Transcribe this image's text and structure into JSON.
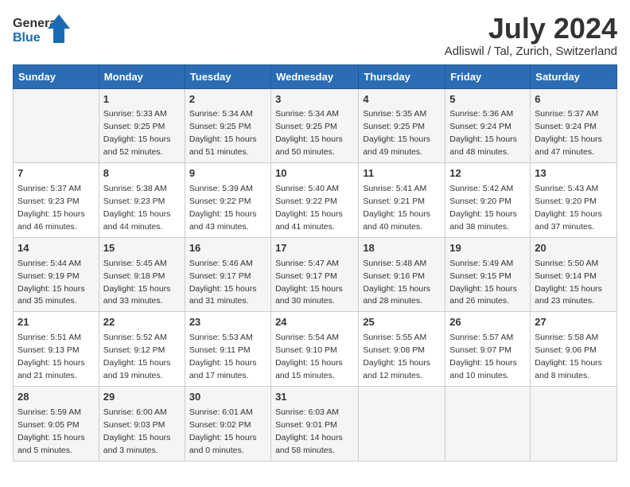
{
  "header": {
    "logo_general": "General",
    "logo_blue": "Blue",
    "title": "July 2024",
    "subtitle": "Adliswil / Tal, Zurich, Switzerland"
  },
  "days_of_week": [
    "Sunday",
    "Monday",
    "Tuesday",
    "Wednesday",
    "Thursday",
    "Friday",
    "Saturday"
  ],
  "weeks": [
    [
      {
        "day": "",
        "info": ""
      },
      {
        "day": "1",
        "info": "Sunrise: 5:33 AM\nSunset: 9:25 PM\nDaylight: 15 hours\nand 52 minutes."
      },
      {
        "day": "2",
        "info": "Sunrise: 5:34 AM\nSunset: 9:25 PM\nDaylight: 15 hours\nand 51 minutes."
      },
      {
        "day": "3",
        "info": "Sunrise: 5:34 AM\nSunset: 9:25 PM\nDaylight: 15 hours\nand 50 minutes."
      },
      {
        "day": "4",
        "info": "Sunrise: 5:35 AM\nSunset: 9:25 PM\nDaylight: 15 hours\nand 49 minutes."
      },
      {
        "day": "5",
        "info": "Sunrise: 5:36 AM\nSunset: 9:24 PM\nDaylight: 15 hours\nand 48 minutes."
      },
      {
        "day": "6",
        "info": "Sunrise: 5:37 AM\nSunset: 9:24 PM\nDaylight: 15 hours\nand 47 minutes."
      }
    ],
    [
      {
        "day": "7",
        "info": "Sunrise: 5:37 AM\nSunset: 9:23 PM\nDaylight: 15 hours\nand 46 minutes."
      },
      {
        "day": "8",
        "info": "Sunrise: 5:38 AM\nSunset: 9:23 PM\nDaylight: 15 hours\nand 44 minutes."
      },
      {
        "day": "9",
        "info": "Sunrise: 5:39 AM\nSunset: 9:22 PM\nDaylight: 15 hours\nand 43 minutes."
      },
      {
        "day": "10",
        "info": "Sunrise: 5:40 AM\nSunset: 9:22 PM\nDaylight: 15 hours\nand 41 minutes."
      },
      {
        "day": "11",
        "info": "Sunrise: 5:41 AM\nSunset: 9:21 PM\nDaylight: 15 hours\nand 40 minutes."
      },
      {
        "day": "12",
        "info": "Sunrise: 5:42 AM\nSunset: 9:20 PM\nDaylight: 15 hours\nand 38 minutes."
      },
      {
        "day": "13",
        "info": "Sunrise: 5:43 AM\nSunset: 9:20 PM\nDaylight: 15 hours\nand 37 minutes."
      }
    ],
    [
      {
        "day": "14",
        "info": "Sunrise: 5:44 AM\nSunset: 9:19 PM\nDaylight: 15 hours\nand 35 minutes."
      },
      {
        "day": "15",
        "info": "Sunrise: 5:45 AM\nSunset: 9:18 PM\nDaylight: 15 hours\nand 33 minutes."
      },
      {
        "day": "16",
        "info": "Sunrise: 5:46 AM\nSunset: 9:17 PM\nDaylight: 15 hours\nand 31 minutes."
      },
      {
        "day": "17",
        "info": "Sunrise: 5:47 AM\nSunset: 9:17 PM\nDaylight: 15 hours\nand 30 minutes."
      },
      {
        "day": "18",
        "info": "Sunrise: 5:48 AM\nSunset: 9:16 PM\nDaylight: 15 hours\nand 28 minutes."
      },
      {
        "day": "19",
        "info": "Sunrise: 5:49 AM\nSunset: 9:15 PM\nDaylight: 15 hours\nand 26 minutes."
      },
      {
        "day": "20",
        "info": "Sunrise: 5:50 AM\nSunset: 9:14 PM\nDaylight: 15 hours\nand 23 minutes."
      }
    ],
    [
      {
        "day": "21",
        "info": "Sunrise: 5:51 AM\nSunset: 9:13 PM\nDaylight: 15 hours\nand 21 minutes."
      },
      {
        "day": "22",
        "info": "Sunrise: 5:52 AM\nSunset: 9:12 PM\nDaylight: 15 hours\nand 19 minutes."
      },
      {
        "day": "23",
        "info": "Sunrise: 5:53 AM\nSunset: 9:11 PM\nDaylight: 15 hours\nand 17 minutes."
      },
      {
        "day": "24",
        "info": "Sunrise: 5:54 AM\nSunset: 9:10 PM\nDaylight: 15 hours\nand 15 minutes."
      },
      {
        "day": "25",
        "info": "Sunrise: 5:55 AM\nSunset: 9:08 PM\nDaylight: 15 hours\nand 12 minutes."
      },
      {
        "day": "26",
        "info": "Sunrise: 5:57 AM\nSunset: 9:07 PM\nDaylight: 15 hours\nand 10 minutes."
      },
      {
        "day": "27",
        "info": "Sunrise: 5:58 AM\nSunset: 9:06 PM\nDaylight: 15 hours\nand 8 minutes."
      }
    ],
    [
      {
        "day": "28",
        "info": "Sunrise: 5:59 AM\nSunset: 9:05 PM\nDaylight: 15 hours\nand 5 minutes."
      },
      {
        "day": "29",
        "info": "Sunrise: 6:00 AM\nSunset: 9:03 PM\nDaylight: 15 hours\nand 3 minutes."
      },
      {
        "day": "30",
        "info": "Sunrise: 6:01 AM\nSunset: 9:02 PM\nDaylight: 15 hours\nand 0 minutes."
      },
      {
        "day": "31",
        "info": "Sunrise: 6:03 AM\nSunset: 9:01 PM\nDaylight: 14 hours\nand 58 minutes."
      },
      {
        "day": "",
        "info": ""
      },
      {
        "day": "",
        "info": ""
      },
      {
        "day": "",
        "info": ""
      }
    ]
  ]
}
